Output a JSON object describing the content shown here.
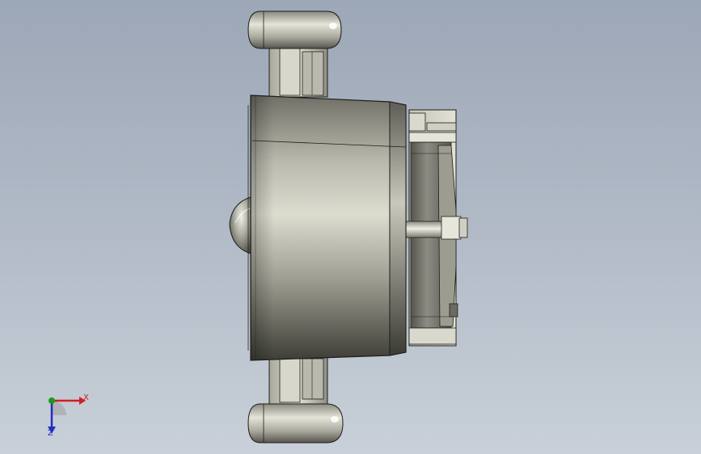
{
  "viewport": {
    "background_top": "#9ca7b7",
    "background_bottom": "#c9d0d9"
  },
  "triad": {
    "x_label": "X",
    "z_label": "Z",
    "x_color": "#d02020",
    "y_color": "#1a9a1a",
    "z_color": "#2030c0"
  }
}
